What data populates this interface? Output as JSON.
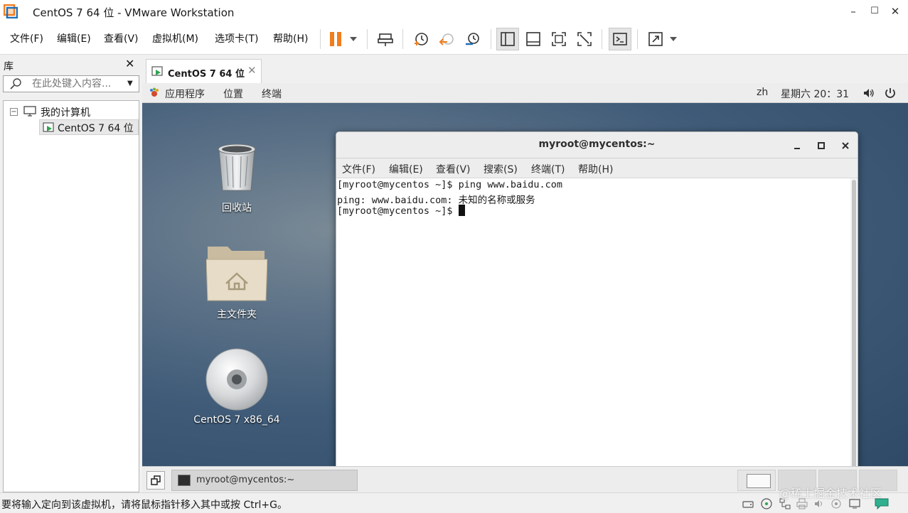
{
  "window": {
    "title": "CentOS 7 64 位 - VMware Workstation",
    "minimize": "–",
    "maximize": "☐",
    "close": "✕"
  },
  "menu": {
    "items": [
      "文件(F)",
      "编辑(E)",
      "查看(V)",
      "虚拟机(M)",
      "选项卡(T)",
      "帮助(H)"
    ]
  },
  "toolbar": {
    "icons": [
      "pause-icon",
      "send-keys-icon",
      "snapshot-icon",
      "revert-snapshot-icon",
      "snapshot-manager-icon",
      "library-view-icon",
      "thumbnail-bar-icon",
      "fullscreen-icon",
      "unity-icon",
      "console-icon",
      "stretch-icon"
    ],
    "accent": "#f07d1e"
  },
  "library": {
    "title": "库",
    "close": "✕",
    "search_placeholder": "在此处键入内容...",
    "tree": {
      "toggle": "−",
      "root": "我的计算机",
      "child": "CentOS 7 64 位"
    }
  },
  "tab": {
    "label": "CentOS 7 64 位",
    "close": "✕"
  },
  "guest": {
    "topbar": {
      "apps": "应用程序",
      "places": "位置",
      "terminal": "终端",
      "lang": "zh",
      "clock": "星期六  20：31"
    },
    "desktop_icons": [
      {
        "label": "回收站",
        "icon": "trash-icon"
      },
      {
        "label": "主文件夹",
        "icon": "home-folder-icon"
      },
      {
        "label": "CentOS 7 x86_64",
        "icon": "cd-icon"
      }
    ],
    "terminal": {
      "title": "myroot@mycentos:~",
      "menu": [
        "文件(F)",
        "编辑(E)",
        "查看(V)",
        "搜索(S)",
        "终端(T)",
        "帮助(H)"
      ],
      "lines": [
        "[myroot@mycentos ~]$ ping www.baidu.com",
        "ping: www.baidu.com: 未知的名称或服务"
      ],
      "prompt": "[myroot@mycentos ~]$ "
    },
    "taskbar": {
      "task": "myroot@mycentos:~"
    }
  },
  "status": {
    "text": "要将输入定向到该虚拟机，请将鼠标指针移入其中或按 Ctrl+G。",
    "watermark": "@稀土掘金技术社区"
  }
}
